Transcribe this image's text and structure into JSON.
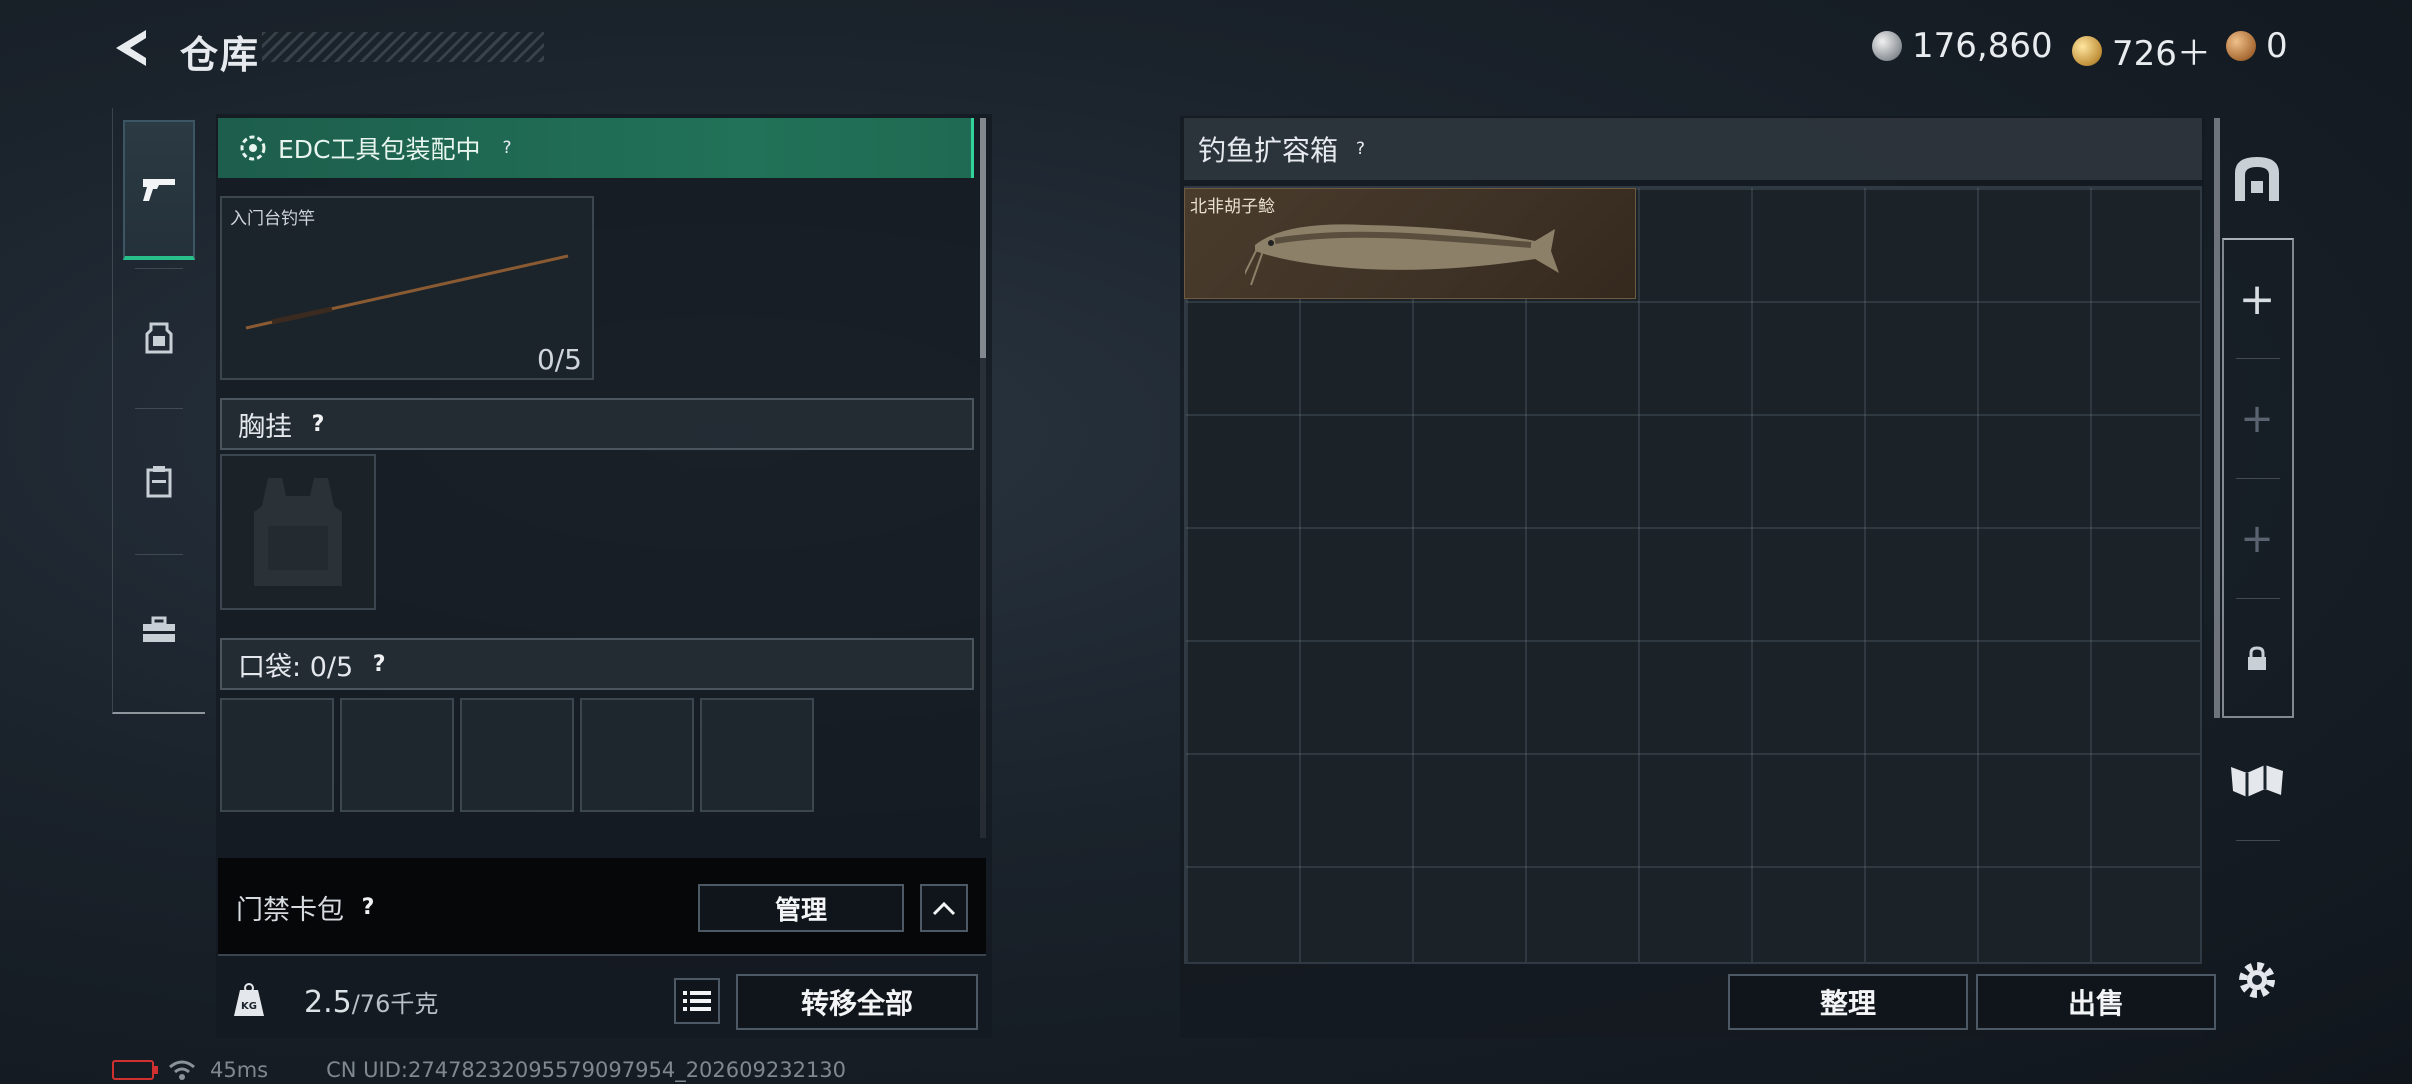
{
  "header": {
    "title": "仓库",
    "currencies": [
      {
        "icon": "silver-coin-icon",
        "value": "176,860"
      },
      {
        "icon": "gold-coin-icon",
        "value": "726＋"
      },
      {
        "icon": "bronze-coin-icon",
        "value": "0"
      }
    ]
  },
  "left_tabs": [
    {
      "icon": "pistol-icon",
      "active": true
    },
    {
      "icon": "chest-rig-icon",
      "active": false
    },
    {
      "icon": "backpack-icon",
      "active": false
    },
    {
      "icon": "toolbox-icon",
      "active": false
    }
  ],
  "edc": {
    "label": "EDC工具包装配中",
    "help": "?"
  },
  "rod_slot": {
    "label": "入门台钓竿",
    "count": "0/5"
  },
  "chest_rig": {
    "label": "胸挂",
    "help": "?"
  },
  "pocket": {
    "label": "口袋: ",
    "count": "0/5",
    "help": "?",
    "slots": 5
  },
  "card_pack": {
    "label": "门禁卡包",
    "help": "?",
    "manage_label": "管理"
  },
  "weight": {
    "value": "2.5",
    "capacity": "/76千克",
    "icon_text": "KG"
  },
  "transfer_all_label": "转移全部",
  "container": {
    "title": "钓鱼扩容箱",
    "help": "?",
    "item_name": "北非胡子鲶"
  },
  "actions": {
    "sort_label": "整理",
    "sell_label": "出售"
  },
  "status": {
    "ping": "45ms",
    "uid": "CN UID:2747823209557909795​4_202609232130"
  },
  "colors": {
    "accent_green": "#28c08a",
    "edc_bar": "#217258"
  }
}
